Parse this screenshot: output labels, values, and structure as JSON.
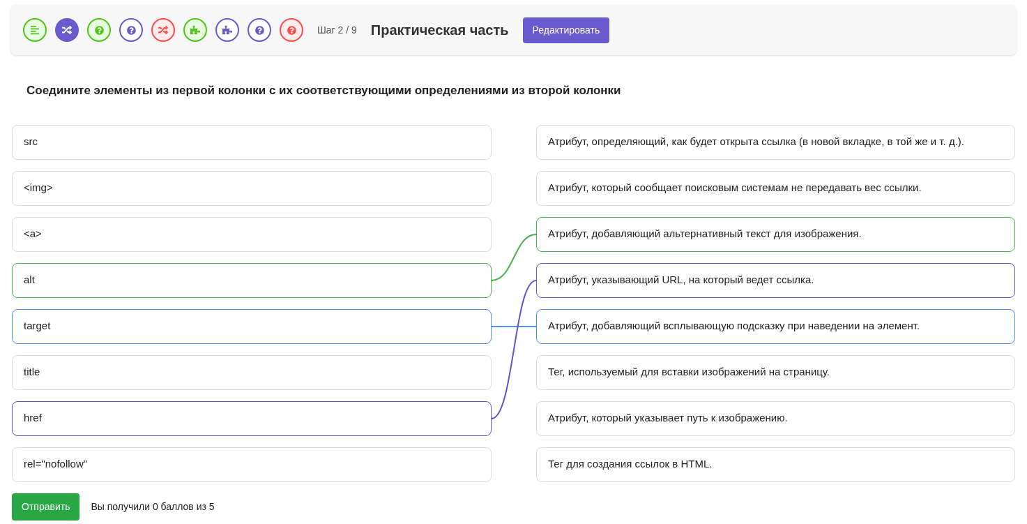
{
  "steps": [
    {
      "kind": "text",
      "color": "#52c41a",
      "selected": false
    },
    {
      "kind": "shuffle",
      "color": "#6a5acd",
      "selected": true
    },
    {
      "kind": "question",
      "color": "#52c41a",
      "selected": false
    },
    {
      "kind": "question",
      "color": "#6a5acd",
      "selected": false
    },
    {
      "kind": "shuffle",
      "color": "#ff4d4f",
      "selected": false
    },
    {
      "kind": "puzzle",
      "color": "#52c41a",
      "selected": false
    },
    {
      "kind": "puzzle",
      "color": "#6a5acd",
      "selected": false
    },
    {
      "kind": "question",
      "color": "#6a5acd",
      "selected": false
    },
    {
      "kind": "question",
      "color": "#ff4d4f",
      "selected": false
    }
  ],
  "step_counter": "Шаг 2 / 9",
  "title": "Практическая часть",
  "edit_button": "Редактировать",
  "question": "Соедините элементы из первой колонки с их соответствующими определениями из второй колонки",
  "left_items": [
    {
      "text": "src"
    },
    {
      "text": "<img>"
    },
    {
      "text": "<a>"
    },
    {
      "text": "alt",
      "color": "#4caf50"
    },
    {
      "text": "target",
      "color": "#4f8ef7"
    },
    {
      "text": "title"
    },
    {
      "text": "href",
      "color": "#6a4fcf"
    },
    {
      "text": "rel=\"nofollow\""
    }
  ],
  "right_items": [
    {
      "text": "Атрибут, определяющий, как будет открыта ссылка (в новой вкладке, в той же и т. д.)."
    },
    {
      "text": "Атрибут, который сообщает поисковым системам не передавать вес ссылки."
    },
    {
      "text": "Атрибут, добавляющий альтернативный текст для изображения.",
      "color": "#4caf50"
    },
    {
      "text": "Атрибут, указывающий URL, на который ведет ссылка.",
      "color": "#6a4fcf"
    },
    {
      "text": "Атрибут, добавляющий всплывающую подсказку при наведении на элемент.",
      "color": "#4f8ef7"
    },
    {
      "text": "Тег, используемый для вставки изображений на страницу."
    },
    {
      "text": "Атрибут, который указывает путь к изображению."
    },
    {
      "text": "Тег для создания ссылок в HTML."
    }
  ],
  "submit_button": "Отправить",
  "score": "Вы получили 0 баллов из 5"
}
